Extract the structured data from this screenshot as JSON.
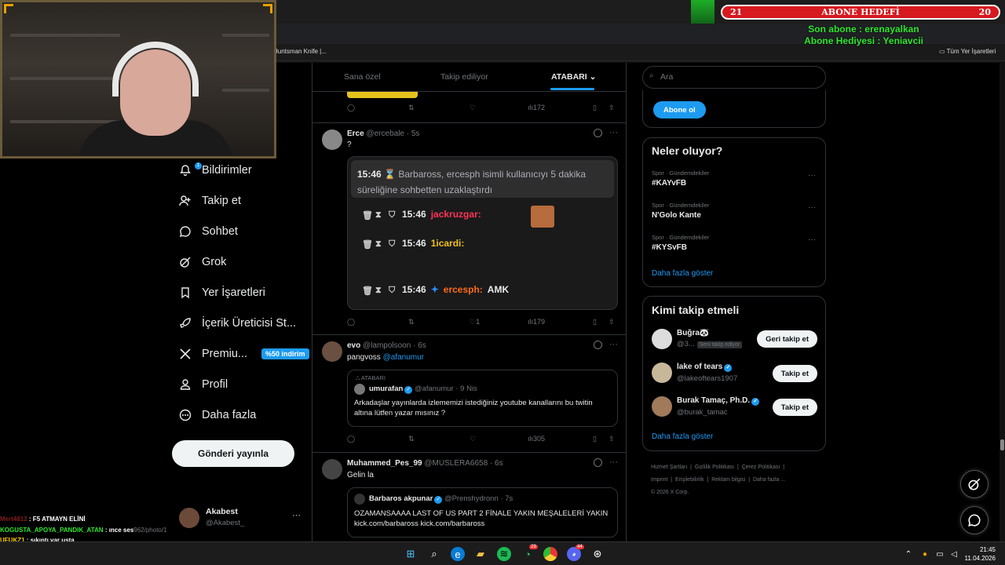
{
  "overlay": {
    "abone_left": "21",
    "abone_title": "ABONE HEDEFİ",
    "abone_right": "20",
    "son_abone": "Son abone : erenayalkan",
    "abone_hediyesi": "Abone Hediyesi : Yeniavcii"
  },
  "bookmarks": {
    "item1": "Huntsman Knife |...",
    "all_bookmarks": "Tüm Yer İşaretleri"
  },
  "nav": {
    "items": [
      {
        "label": "Bildirimler",
        "icon": "bell-icon"
      },
      {
        "label": "Takip et",
        "icon": "add-user-icon"
      },
      {
        "label": "Sohbet",
        "icon": "chat-icon"
      },
      {
        "label": "Grok",
        "icon": "grok-icon"
      },
      {
        "label": "Yer İşaretleri",
        "icon": "bookmark-icon"
      },
      {
        "label": "İçerik Üreticisi St...",
        "icon": "rocket-icon"
      },
      {
        "label": "Premiu...",
        "icon": "x-logo-icon"
      },
      {
        "label": "Profil",
        "icon": "person-icon"
      },
      {
        "label": "Daha fazla",
        "icon": "more-circle-icon"
      }
    ],
    "notif_badge": "1",
    "premium_promo": "%50 indirim",
    "post_button": "Gönderi yayınla",
    "profile_name": "Akabest",
    "profile_handle": "@Akabest_",
    "profile_more": "···"
  },
  "tabs": {
    "for_you": "Sana özel",
    "following": "Takip ediliyor",
    "custom": "ATABARI"
  },
  "posts": [
    {
      "actions": {
        "views": "172"
      }
    },
    {
      "name": "Erce",
      "handle": "@ercebale",
      "time": "· 5s",
      "text": "?",
      "media": {
        "header_time": "15:46",
        "header_text": "Barbaross, ercesph isimli kullanıcıyı 5 dakika süreliğine sohbetten uzaklaştırdı",
        "lines": [
          {
            "time": "15:46",
            "user": "jackruzgar:",
            "msg": ""
          },
          {
            "time": "15:46",
            "user": "1icardi:",
            "msg": ""
          },
          {
            "time": "15:46",
            "user": "ercesph:",
            "msg": "AMK"
          }
        ]
      },
      "actions": {
        "likes": "1",
        "views": "179"
      }
    },
    {
      "name": "evo",
      "handle": "@lampolsoon",
      "time": "· 6s",
      "text": "pangvoss",
      "mention": "@afanumur",
      "quote": {
        "community": "ATABARI",
        "name": "umurafan",
        "handle": "@afanumur",
        "time": "· 9 Nis",
        "text": "Arkadaşlar yayınlarda izlememizi istediğiniz youtube kanallarını bu twitin altına lütfen yazar mısınız ?"
      },
      "actions": {
        "views": "305"
      }
    },
    {
      "name": "Muhammed_Pes_99",
      "handle": "@MUSLERA6658",
      "time": "· 6s",
      "text": "Gelin la",
      "quote": {
        "name": "Barbaros akpunar",
        "handle": "@Prenshydronn",
        "time": "· 7s",
        "text": "OZAMANSAAAA LAST OF US PART 2 FİNALE YAKIN  MEŞALELERİ YAKIN kick.com/barbaross kick.com/barbaross"
      }
    }
  ],
  "right": {
    "search_placeholder": "Ara",
    "subscribe": "Abone ol",
    "trends_title": "Neler oluyor?",
    "trends": [
      {
        "category": "Spor · Gündemdekiler",
        "name": "#KAYvFB"
      },
      {
        "category": "Spor · Gündemdekiler",
        "name": "N'Golo Kante"
      },
      {
        "category": "Spor · Gündemdekiler",
        "name": "#KYSvFB"
      }
    ],
    "show_more": "Daha fazla göster",
    "who_title": "Kimi takip etmeli",
    "who": [
      {
        "name": "Buğra🐼",
        "handle": "@3...",
        "tag": "Seni takip ediyor",
        "button": "Geri takip et"
      },
      {
        "name": "lake of tears",
        "handle": "@lakeoftears1907",
        "button": "Takip et"
      },
      {
        "name": "Burak Tamaç, Ph.D.",
        "handle": "@burak_tamac",
        "button": "Takip et"
      }
    ],
    "who_show_more": "Daha fazla göster",
    "footer": [
      "Hizmet Şartları",
      "Gizlilik Politikası",
      "Çerez Politikası",
      "Imprint",
      "Erişilebilirlik",
      "Reklam bilgisi",
      "Daha fazla ...",
      "© 2026 X Corp."
    ]
  },
  "chat": [
    {
      "user": "Mert4812",
      "msg": ": F5 ATMAYN ELİNİ",
      "color": "#ff3b3b"
    },
    {
      "user": "KOGUSTA_APOYA_PANDIK_ATAN",
      "msg": ": ınce ses",
      "color": "#2de82d"
    },
    {
      "user": "UFUKZ1",
      "msg": ": sıkıntı var usta",
      "color": "#ffd000"
    },
    {
      "user": "furkmyyi",
      "msg": ":",
      "color": "#ff4040"
    }
  ],
  "url_fragment": "962/photo/1",
  "taskbar": {
    "time": "21:45",
    "date": "11.04.2026",
    "whatsapp_badge": "29",
    "discord_badge": "44"
  }
}
